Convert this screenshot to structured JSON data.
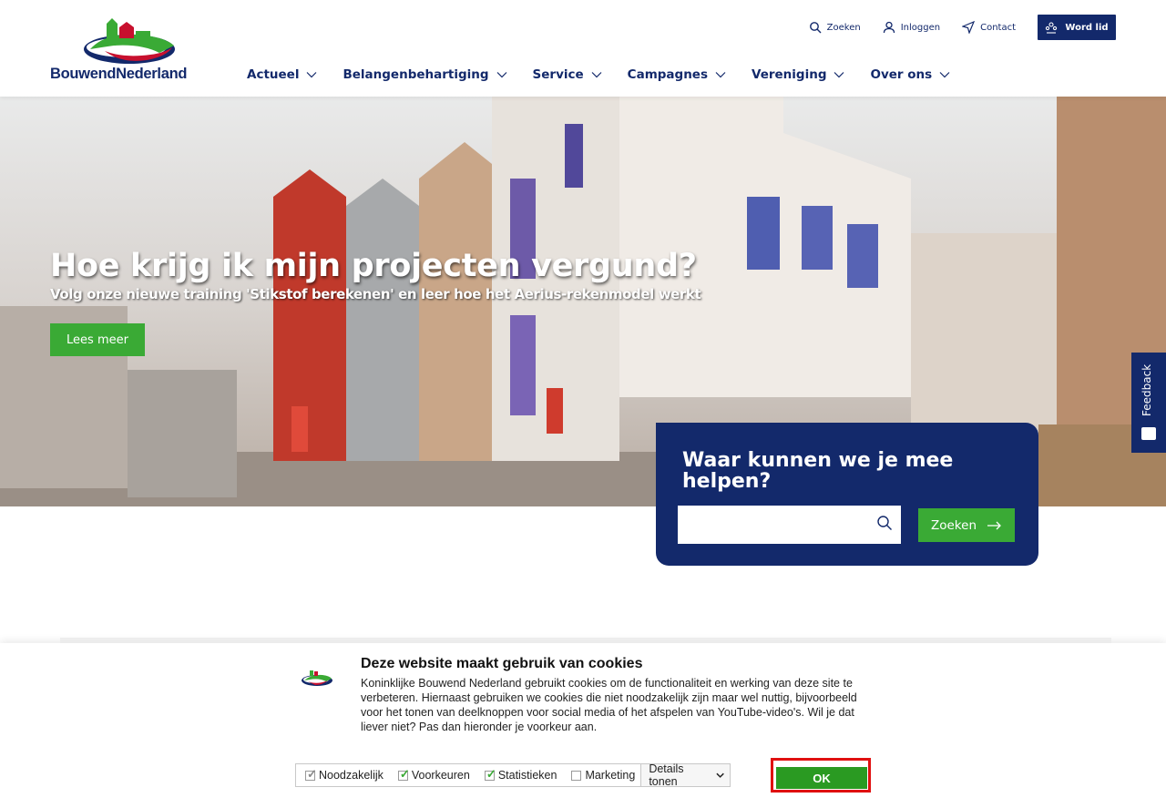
{
  "brand": {
    "name": "BouwendNederland",
    "colors": {
      "navy": "#13296b",
      "green": "#3aaa35",
      "red": "#c8102e",
      "okOutline": "#e01010"
    }
  },
  "utility": {
    "search_label": "Zoeken",
    "login_label": "Inloggen",
    "contact_label": "Contact",
    "join_label": "Word lid"
  },
  "nav": {
    "items": [
      {
        "label": "Actueel"
      },
      {
        "label": "Belangenbehartiging"
      },
      {
        "label": "Service"
      },
      {
        "label": "Campagnes"
      },
      {
        "label": "Vereniging"
      },
      {
        "label": "Over ons"
      }
    ]
  },
  "hero": {
    "title": "Hoe krijg ik mijn projecten vergund?",
    "subtitle": "Volg onze nieuwe training 'Stikstof berekenen' en leer hoe het Aerius-rekenmodel werkt",
    "cta": "Lees meer"
  },
  "feedback": {
    "label": "Feedback"
  },
  "search": {
    "title": "Waar kunnen we je mee helpen?",
    "input_value": "",
    "button_label": "Zoeken"
  },
  "cookies": {
    "title": "Deze website maakt gebruik van cookies",
    "text": "Koninklijke Bouwend Nederland gebruikt cookies om de functionaliteit en werking van deze site te verbeteren. Hiernaast gebruiken we cookies die niet noodzakelijk zijn maar wel nuttig, bijvoorbeeld voor het tonen van deelknoppen voor social media of het afspelen van YouTube-video's. Wil je dat liever niet? Pas dan hieronder je voorkeur aan.",
    "options": [
      {
        "label": "Noodzakelijk",
        "checked": true
      },
      {
        "label": "Voorkeuren",
        "checked": true
      },
      {
        "label": "Statistieken",
        "checked": true
      },
      {
        "label": "Marketing",
        "checked": false
      }
    ],
    "details_label": "Details tonen",
    "ok_label": "OK"
  }
}
